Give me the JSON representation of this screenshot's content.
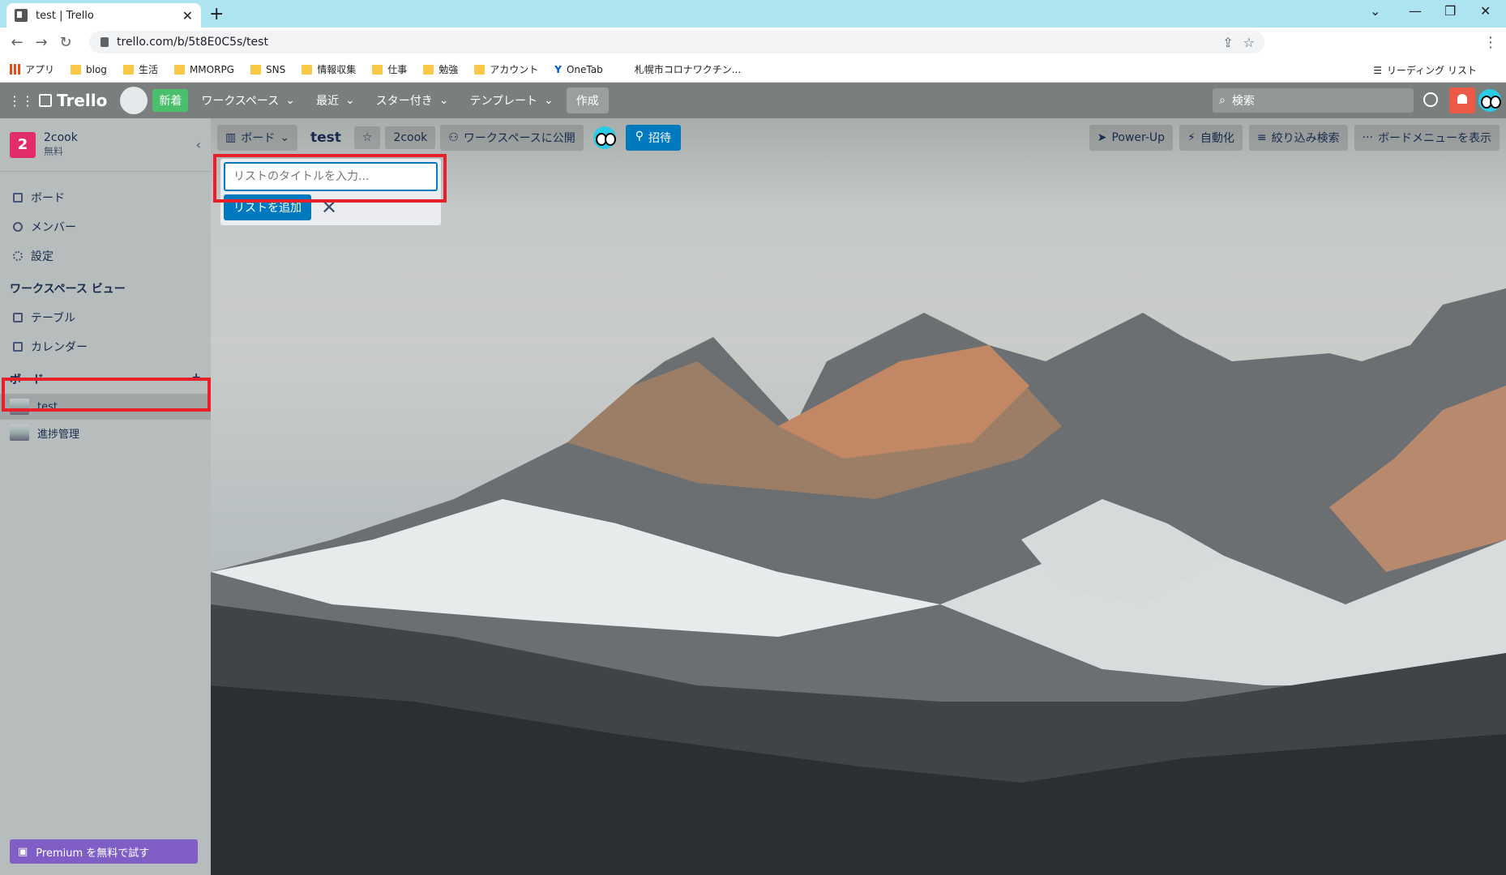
{
  "browser": {
    "tab_title": "test | Trello",
    "tab_close": "✕",
    "new_tab": "+",
    "url": "trello.com/b/5t8E0C5s/test",
    "bookmarks": [
      "アプリ",
      "blog",
      "生活",
      "MMORPG",
      "SNS",
      "情報収集",
      "仕事",
      "勉強",
      "アカウント",
      "OneTab",
      "札幌市コロナワクチン..."
    ],
    "reading_list": "リーディング リスト"
  },
  "header": {
    "logo": "Trello",
    "new_badge": "新着",
    "menus": [
      "ワークスペース",
      "最近",
      "スター付き",
      "テンプレート"
    ],
    "create": "作成",
    "search_placeholder": "検索"
  },
  "sidebar": {
    "workspace_initial": "2",
    "workspace_name": "2cook",
    "workspace_plan": "無料",
    "items": [
      "ボード",
      "メンバー",
      "設定"
    ],
    "views_heading": "ワークスペース ビュー",
    "views": [
      "テーブル",
      "カレンダー"
    ],
    "boards_heading": "ボード",
    "boards": [
      "test",
      "進捗管理"
    ],
    "premium": "Premium を無料で試す"
  },
  "board": {
    "view_button": "ボード",
    "title": "test",
    "workspace": "2cook",
    "visibility": "ワークスペースに公開",
    "invite": "招待",
    "right_buttons": [
      "Power-Up",
      "自動化",
      "絞り込み検索",
      "ボードメニューを表示"
    ]
  },
  "add_list": {
    "placeholder": "リストのタイトルを入力...",
    "button": "リストを追加"
  }
}
